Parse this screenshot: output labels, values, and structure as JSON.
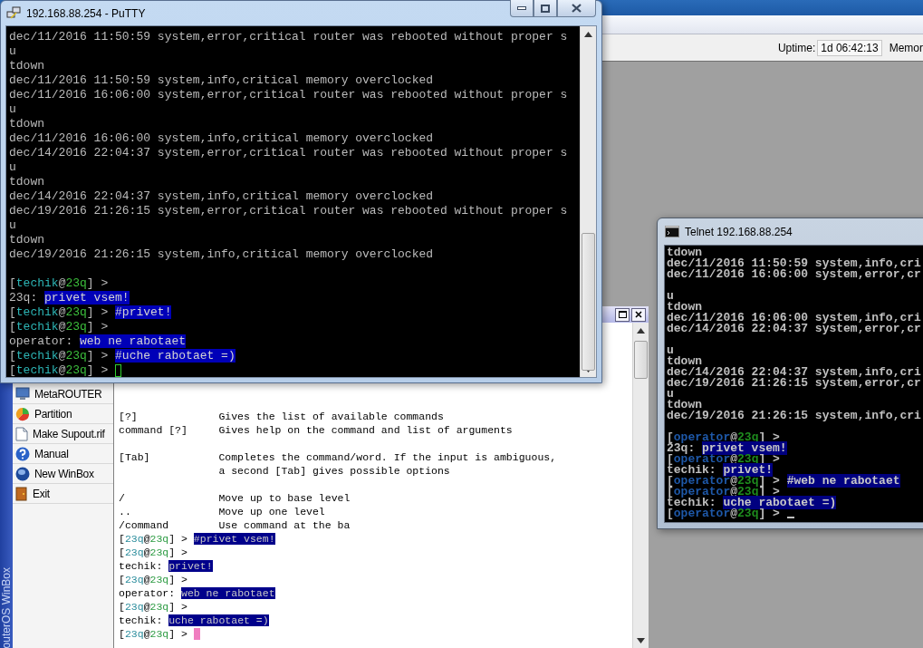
{
  "winbox": {
    "strip_label": "outerOS WinBox",
    "uptime_label": "Uptime:",
    "uptime": "1d 06:42:13",
    "memory_label": "Memor",
    "menu": [
      {
        "label": "MetaROUTER"
      },
      {
        "label": "Partition"
      },
      {
        "label": "Make Supout.rif"
      },
      {
        "label": "Manual"
      },
      {
        "label": "New WinBox"
      },
      {
        "label": "Exit"
      }
    ],
    "terminal": {
      "lines": [
        {
          "kind": "blank"
        },
        {
          "kind": "blank"
        },
        {
          "kind": "text",
          "text": "[?]             Gives the list of available commands"
        },
        {
          "kind": "text",
          "text": "command [?]     Gives help on the command and list of arguments"
        },
        {
          "kind": "blank"
        },
        {
          "kind": "text",
          "text": "[Tab]           Completes the command/word. If the input is ambiguous,"
        },
        {
          "kind": "text",
          "text": "                a second [Tab] gives possible options"
        },
        {
          "kind": "blank"
        },
        {
          "kind": "text",
          "text": "/               Move up to base level"
        },
        {
          "kind": "text",
          "text": "..              Move up one level"
        },
        {
          "kind": "text",
          "text": "/command        Use command at the ba"
        },
        {
          "kind": "chat",
          "segments": [
            {
              "kind": "plain",
              "text": "["
            },
            {
              "kind": "user",
              "text": "23q"
            },
            {
              "kind": "plain",
              "text": "@"
            },
            {
              "kind": "host",
              "text": "23q"
            },
            {
              "kind": "plain",
              "text": "] > "
            },
            {
              "kind": "marked",
              "text": "#privet vsem!"
            }
          ]
        },
        {
          "kind": "chat",
          "segments": [
            {
              "kind": "plain",
              "text": "["
            },
            {
              "kind": "user",
              "text": "23q"
            },
            {
              "kind": "plain",
              "text": "@"
            },
            {
              "kind": "host",
              "text": "23q"
            },
            {
              "kind": "plain",
              "text": "] >"
            }
          ]
        },
        {
          "kind": "chat",
          "segments": [
            {
              "kind": "plain",
              "text": "techik: "
            },
            {
              "kind": "marked",
              "text": "privet!"
            }
          ]
        },
        {
          "kind": "chat",
          "segments": [
            {
              "kind": "plain",
              "text": "["
            },
            {
              "kind": "user",
              "text": "23q"
            },
            {
              "kind": "plain",
              "text": "@"
            },
            {
              "kind": "host",
              "text": "23q"
            },
            {
              "kind": "plain",
              "text": "] >"
            }
          ]
        },
        {
          "kind": "chat",
          "segments": [
            {
              "kind": "plain",
              "text": "operator: "
            },
            {
              "kind": "marked",
              "text": "web ne rabotaet"
            }
          ]
        },
        {
          "kind": "chat",
          "segments": [
            {
              "kind": "plain",
              "text": "["
            },
            {
              "kind": "user",
              "text": "23q"
            },
            {
              "kind": "plain",
              "text": "@"
            },
            {
              "kind": "host",
              "text": "23q"
            },
            {
              "kind": "plain",
              "text": "] >"
            }
          ]
        },
        {
          "kind": "chat",
          "segments": [
            {
              "kind": "plain",
              "text": "techik: "
            },
            {
              "kind": "marked",
              "text": "uche rabotaet =)"
            }
          ]
        },
        {
          "kind": "chat",
          "segments": [
            {
              "kind": "plain",
              "text": "["
            },
            {
              "kind": "user",
              "text": "23q"
            },
            {
              "kind": "plain",
              "text": "@"
            },
            {
              "kind": "host",
              "text": "23q"
            },
            {
              "kind": "plain",
              "text": "] > "
            },
            {
              "kind": "cursor"
            }
          ]
        }
      ]
    }
  },
  "putty": {
    "title": "192.168.88.254 - PuTTY",
    "lines": [
      {
        "kind": "text",
        "text": "dec/11/2016 11:50:59 system,error,critical router was rebooted without proper s"
      },
      {
        "kind": "text",
        "text": "u"
      },
      {
        "kind": "text",
        "text": "tdown"
      },
      {
        "kind": "text",
        "text": "dec/11/2016 11:50:59 system,info,critical memory overclocked"
      },
      {
        "kind": "text",
        "text": "dec/11/2016 16:06:00 system,error,critical router was rebooted without proper s"
      },
      {
        "kind": "text",
        "text": "u"
      },
      {
        "kind": "text",
        "text": "tdown"
      },
      {
        "kind": "text",
        "text": "dec/11/2016 16:06:00 system,info,critical memory overclocked"
      },
      {
        "kind": "text",
        "text": "dec/14/2016 22:04:37 system,error,critical router was rebooted without proper s"
      },
      {
        "kind": "text",
        "text": "u"
      },
      {
        "kind": "text",
        "text": "tdown"
      },
      {
        "kind": "text",
        "text": "dec/14/2016 22:04:37 system,info,critical memory overclocked"
      },
      {
        "kind": "text",
        "text": "dec/19/2016 21:26:15 system,error,critical router was rebooted without proper s"
      },
      {
        "kind": "text",
        "text": "u"
      },
      {
        "kind": "text",
        "text": "tdown"
      },
      {
        "kind": "text",
        "text": "dec/19/2016 21:26:15 system,info,critical memory overclocked"
      },
      {
        "kind": "blank"
      },
      {
        "kind": "chat",
        "segments": [
          {
            "kind": "plain",
            "text": "["
          },
          {
            "kind": "user",
            "text": "techik"
          },
          {
            "kind": "plain",
            "text": "@"
          },
          {
            "kind": "host",
            "text": "23q"
          },
          {
            "kind": "plain",
            "text": "] >"
          }
        ]
      },
      {
        "kind": "chat",
        "segments": [
          {
            "kind": "plain",
            "text": "23q: "
          },
          {
            "kind": "marked",
            "text": "privet vsem!"
          }
        ]
      },
      {
        "kind": "chat",
        "segments": [
          {
            "kind": "plain",
            "text": "["
          },
          {
            "kind": "user",
            "text": "techik"
          },
          {
            "kind": "plain",
            "text": "@"
          },
          {
            "kind": "host",
            "text": "23q"
          },
          {
            "kind": "plain",
            "text": "] > "
          },
          {
            "kind": "marked",
            "text": "#privet!"
          }
        ]
      },
      {
        "kind": "chat",
        "segments": [
          {
            "kind": "plain",
            "text": "["
          },
          {
            "kind": "user",
            "text": "techik"
          },
          {
            "kind": "plain",
            "text": "@"
          },
          {
            "kind": "host",
            "text": "23q"
          },
          {
            "kind": "plain",
            "text": "] >"
          }
        ]
      },
      {
        "kind": "chat",
        "segments": [
          {
            "kind": "plain",
            "text": "operator: "
          },
          {
            "kind": "marked",
            "text": "web ne rabotaet"
          }
        ]
      },
      {
        "kind": "chat",
        "segments": [
          {
            "kind": "plain",
            "text": "["
          },
          {
            "kind": "user",
            "text": "techik"
          },
          {
            "kind": "plain",
            "text": "@"
          },
          {
            "kind": "host",
            "text": "23q"
          },
          {
            "kind": "plain",
            "text": "] > "
          },
          {
            "kind": "marked",
            "text": "#uche rabotaet =)"
          }
        ]
      },
      {
        "kind": "chat",
        "segments": [
          {
            "kind": "plain",
            "text": "["
          },
          {
            "kind": "user",
            "text": "techik"
          },
          {
            "kind": "plain",
            "text": "@"
          },
          {
            "kind": "host",
            "text": "23q"
          },
          {
            "kind": "plain",
            "text": "] > "
          },
          {
            "kind": "cursor"
          }
        ]
      }
    ]
  },
  "telnet": {
    "title": "Telnet 192.168.88.254",
    "lines": [
      {
        "kind": "text",
        "text": "tdown"
      },
      {
        "kind": "text",
        "text": "dec/11/2016 11:50:59 system,info,cri"
      },
      {
        "kind": "text",
        "text": "dec/11/2016 16:06:00 system,error,cr"
      },
      {
        "kind": "blank"
      },
      {
        "kind": "text",
        "text": "u"
      },
      {
        "kind": "text",
        "text": "tdown"
      },
      {
        "kind": "text",
        "text": "dec/11/2016 16:06:00 system,info,cri"
      },
      {
        "kind": "text",
        "text": "dec/14/2016 22:04:37 system,error,cr"
      },
      {
        "kind": "blank"
      },
      {
        "kind": "text",
        "text": "u"
      },
      {
        "kind": "text",
        "text": "tdown"
      },
      {
        "kind": "text",
        "text": "dec/14/2016 22:04:37 system,info,cri"
      },
      {
        "kind": "text",
        "text": "dec/19/2016 21:26:15 system,error,cr"
      },
      {
        "kind": "text",
        "text": "u"
      },
      {
        "kind": "text",
        "text": "tdown"
      },
      {
        "kind": "text",
        "text": "dec/19/2016 21:26:15 system,info,cri"
      },
      {
        "kind": "blank"
      },
      {
        "kind": "chat",
        "segments": [
          {
            "kind": "plain",
            "text": "["
          },
          {
            "kind": "user",
            "text": "operator"
          },
          {
            "kind": "plain",
            "text": "@"
          },
          {
            "kind": "host",
            "text": "23q"
          },
          {
            "kind": "plain",
            "text": "] >"
          }
        ]
      },
      {
        "kind": "chat",
        "segments": [
          {
            "kind": "plain",
            "text": "23q: "
          },
          {
            "kind": "marked",
            "text": "privet vsem!"
          }
        ]
      },
      {
        "kind": "chat",
        "segments": [
          {
            "kind": "plain",
            "text": "["
          },
          {
            "kind": "user",
            "text": "operator"
          },
          {
            "kind": "plain",
            "text": "@"
          },
          {
            "kind": "host",
            "text": "23q"
          },
          {
            "kind": "plain",
            "text": "] >"
          }
        ]
      },
      {
        "kind": "chat",
        "segments": [
          {
            "kind": "plain",
            "text": "techik: "
          },
          {
            "kind": "marked",
            "text": "privet!"
          }
        ]
      },
      {
        "kind": "chat",
        "segments": [
          {
            "kind": "plain",
            "text": "["
          },
          {
            "kind": "user",
            "text": "operator"
          },
          {
            "kind": "plain",
            "text": "@"
          },
          {
            "kind": "host",
            "text": "23q"
          },
          {
            "kind": "plain",
            "text": "] > "
          },
          {
            "kind": "marked",
            "text": "#web ne rabotaet"
          }
        ]
      },
      {
        "kind": "chat",
        "segments": [
          {
            "kind": "plain",
            "text": "["
          },
          {
            "kind": "user",
            "text": "operator"
          },
          {
            "kind": "plain",
            "text": "@"
          },
          {
            "kind": "host",
            "text": "23q"
          },
          {
            "kind": "plain",
            "text": "] >"
          }
        ]
      },
      {
        "kind": "chat",
        "segments": [
          {
            "kind": "plain",
            "text": "techik: "
          },
          {
            "kind": "marked",
            "text": "uche rabotaet =)"
          }
        ]
      },
      {
        "kind": "chat",
        "segments": [
          {
            "kind": "plain",
            "text": "["
          },
          {
            "kind": "user",
            "text": "operator"
          },
          {
            "kind": "plain",
            "text": "@"
          },
          {
            "kind": "host",
            "text": "23q"
          },
          {
            "kind": "plain",
            "text": "] > "
          },
          {
            "kind": "cursor"
          }
        ]
      }
    ]
  }
}
